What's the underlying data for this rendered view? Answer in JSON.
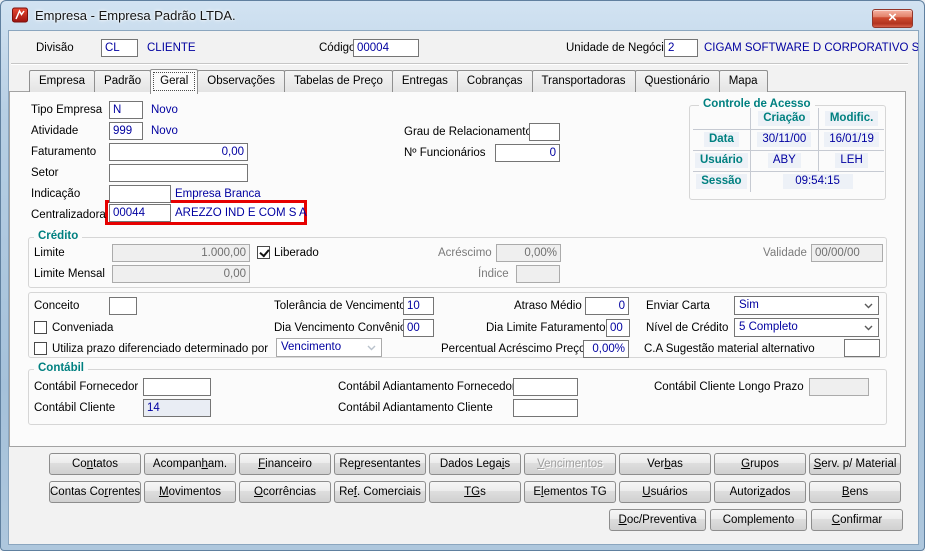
{
  "window": {
    "title": "Empresa - Empresa Padrão LTDA.",
    "close_glyph": "×"
  },
  "header": {
    "divisao_label": "Divisão",
    "divisao_value": "CL",
    "divisao_desc": "CLIENTE",
    "codigo_label": "Código",
    "codigo_value": "00004",
    "unidade_label": "Unidade de Negócio",
    "unidade_value": "2",
    "unidade_desc": "CIGAM SOFTWARE D CORPORATIVO S.A"
  },
  "tabs": {
    "active_index": 2,
    "items": [
      "Empresa",
      "Padrão",
      "Geral",
      "Observações",
      "Tabelas de Preço",
      "Entregas",
      "Cobranças",
      "Transportadoras",
      "Questionário",
      "Mapa"
    ]
  },
  "general": {
    "tipo_empresa_label": "Tipo Empresa",
    "tipo_empresa_value": "N",
    "tipo_empresa_desc": "Novo",
    "atividade_label": "Atividade",
    "atividade_value": "999",
    "atividade_desc": "Novo",
    "faturamento_label": "Faturamento",
    "faturamento_value": "0,00",
    "setor_label": "Setor",
    "setor_value": "",
    "indicacao_label": "Indicação",
    "indicacao_value": "",
    "indicacao_desc": "Empresa Branca",
    "centralizadora_label": "Centralizadora",
    "centralizadora_value": "00044",
    "centralizadora_desc": "AREZZO IND E COM S A",
    "grau_label": "Grau de Relacionamento",
    "grau_value": "",
    "funcionarios_label": "Nº Funcionários",
    "funcionarios_value": "0"
  },
  "acesso": {
    "title": "Controle de Acesso",
    "col_criacao": "Criação",
    "col_modific": "Modific.",
    "row_data_label": "Data",
    "data_criacao": "30/11/00",
    "data_modific": "16/01/19",
    "row_usuario_label": "Usuário",
    "usuario_criacao": "ABY",
    "usuario_modific": "LEH",
    "row_sessao_label": "Sessão",
    "sessao_value": "09:54:15"
  },
  "credito": {
    "title": "Crédito",
    "limite_label": "Limite",
    "limite_value": "1.000,00",
    "liberado_label": "Liberado",
    "liberado_checked": true,
    "acrescimo_label": "Acréscimo",
    "acrescimo_value": "0,00%",
    "validade_label": "Validade",
    "validade_value": "00/00/00",
    "limite_mensal_label": "Limite Mensal",
    "limite_mensal_value": "0,00",
    "indice_label": "Índice",
    "indice_value": ""
  },
  "condicoes": {
    "conceito_label": "Conceito",
    "conceito_value": "",
    "tolerancia_label": "Tolerância de Vencimento",
    "tolerancia_value": "10",
    "atraso_label": "Atraso Médio",
    "atraso_value": "0",
    "enviar_carta_label": "Enviar Carta",
    "enviar_carta_value": "Sim",
    "conveniada_label": "Conveniada",
    "conveniada_checked": false,
    "dia_venc_label": "Dia Vencimento Convênio",
    "dia_venc_value": "00",
    "dia_limite_label": "Dia Limite Faturamento",
    "dia_limite_value": "00",
    "nivel_label": "Nível de Crédito",
    "nivel_value": "5 Completo",
    "utiliza_label": "Utiliza prazo diferenciado determinado por",
    "utiliza_checked": false,
    "prazo_value": "Vencimento",
    "percentual_label": "Percentual Acréscimo Preço",
    "percentual_value": "0,00%",
    "ca_label": "C.A Sugestão material alternativo",
    "ca_value": ""
  },
  "contabil": {
    "title": "Contábil",
    "fornecedor_label": "Contábil Fornecedor",
    "fornecedor_value": "",
    "cliente_label": "Contábil Cliente",
    "cliente_value": "14",
    "adiant_fornecedor_label": "Contábil Adiantamento Fornecedor",
    "adiant_fornecedor_value": "",
    "adiant_cliente_label": "Contábil Adiantamento Cliente",
    "adiant_cliente_value": "",
    "longo_prazo_label": "Contábil Cliente Longo Prazo",
    "longo_prazo_value": ""
  },
  "buttons": {
    "row1": [
      {
        "label": "Contatos",
        "accel": 2
      },
      {
        "label": "Acompanham.",
        "accel": 7
      },
      {
        "label": "Financeiro",
        "accel": 0
      },
      {
        "label": "Representantes",
        "accel": 2
      },
      {
        "label": "Dados Legais",
        "accel": 10
      },
      {
        "label": "Vencimentos",
        "accel": 0,
        "disabled": true
      },
      {
        "label": "Verbas",
        "accel": 3
      },
      {
        "label": "Grupos",
        "accel": 0
      },
      {
        "label": "Serv. p/ Material",
        "accel": 0
      }
    ],
    "row2": [
      {
        "label": "Contas Correntes",
        "accel": 9
      },
      {
        "label": "Movimentos",
        "accel": 0
      },
      {
        "label": "Ocorrências",
        "accel": 0
      },
      {
        "label": "Ref. Comerciais",
        "accel": 2
      },
      {
        "label": "TGs",
        "accel": 0,
        "accel_len": 2
      },
      {
        "label": "Elementos TG",
        "accel": 1
      },
      {
        "label": "Usuários",
        "accel": 0
      },
      {
        "label": "Autorizados",
        "accel": 6
      },
      {
        "label": "Bens",
        "accel": 0
      }
    ],
    "row3": [
      {
        "label": "Doc/Preventiva",
        "accel": 0
      },
      {
        "label": "Complemento",
        "accel": -1
      },
      {
        "label": "Confirmar",
        "accel": 0
      }
    ]
  },
  "colors": {
    "accent_navy": "#0000a0",
    "teal": "#008080",
    "highlight_red": "#e60000",
    "icon_red": "#c9161b"
  }
}
